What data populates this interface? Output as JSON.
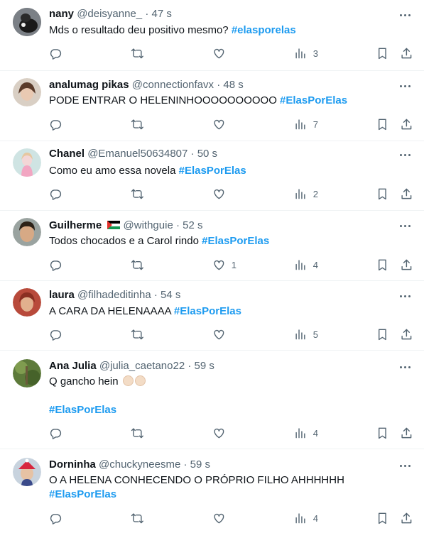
{
  "tweets": [
    {
      "name": "nany",
      "handle": "@deisyanne_",
      "time": "47 s",
      "text": "Mds o resultado deu positivo mesmo?",
      "hashtag": "#elasporelas",
      "likes": "",
      "views": "3"
    },
    {
      "name": "analumag pikas",
      "handle": "@connectionfavx",
      "time": "48 s",
      "text": "PODE ENTRAR O HELENINHOOOOOOOOOO",
      "hashtag": "#ElasPorElas",
      "likes": "",
      "views": "7"
    },
    {
      "name": "Chanel",
      "handle": "@Emanuel50634807",
      "time": "50 s",
      "text": "Como eu amo essa novela",
      "hashtag": "#ElasPorElas",
      "likes": "",
      "views": "2"
    },
    {
      "name": "Guilherme",
      "handle": "@withguie",
      "time": "52 s",
      "text": "Todos chocados e a Carol rindo",
      "hashtag": "#ElasPorElas",
      "likes": "1",
      "views": "4"
    },
    {
      "name": "laura",
      "handle": "@filhadeditinha",
      "time": "54 s",
      "text": "A CARA DA HELENAAAA",
      "hashtag": "#ElasPorElas",
      "likes": "",
      "views": "5"
    },
    {
      "name": "Ana Julia",
      "handle": "@julia_caetano22",
      "time": "59 s",
      "text": "Q gancho hein",
      "hashtag": "#ElasPorElas",
      "likes": "",
      "views": "4"
    },
    {
      "name": "Dorninha",
      "handle": "@chuckyneesme",
      "time": "59 s",
      "text": "O A HELENA CONHECENDO O PRÓPRIO FILHO AHHHHHH",
      "hashtag": "#ElasPorElas",
      "likes": "",
      "views": "4"
    }
  ],
  "separator": "·",
  "icons": {
    "reply": "reply-icon",
    "retweet": "retweet-icon",
    "like": "like-icon",
    "views": "views-icon",
    "bookmark": "bookmark-icon",
    "share": "share-icon",
    "more": "more-icon"
  },
  "colors": {
    "hashtag": "#1d9bf0",
    "secondary": "#536471"
  }
}
